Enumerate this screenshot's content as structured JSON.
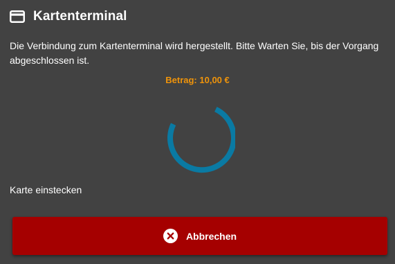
{
  "dialog": {
    "title": "Kartenterminal",
    "title_icon": "credit-card-icon",
    "message": "Die Verbindung zum Kartenterminal wird hergestellt. Bitte Warten Sie, bis der Vorgang abgeschlossen ist.",
    "amount": "Betrag: 10,00 €",
    "status": "Karte einstecken",
    "spinner_icon": "loading-spinner-icon",
    "cancel_button": {
      "label": "Abbrechen",
      "icon": "close-circle-icon"
    }
  },
  "colors": {
    "background": "#424242",
    "amount_text": "#f0940a",
    "spinner": "#0a7aa3",
    "cancel_button": "#a50000"
  }
}
